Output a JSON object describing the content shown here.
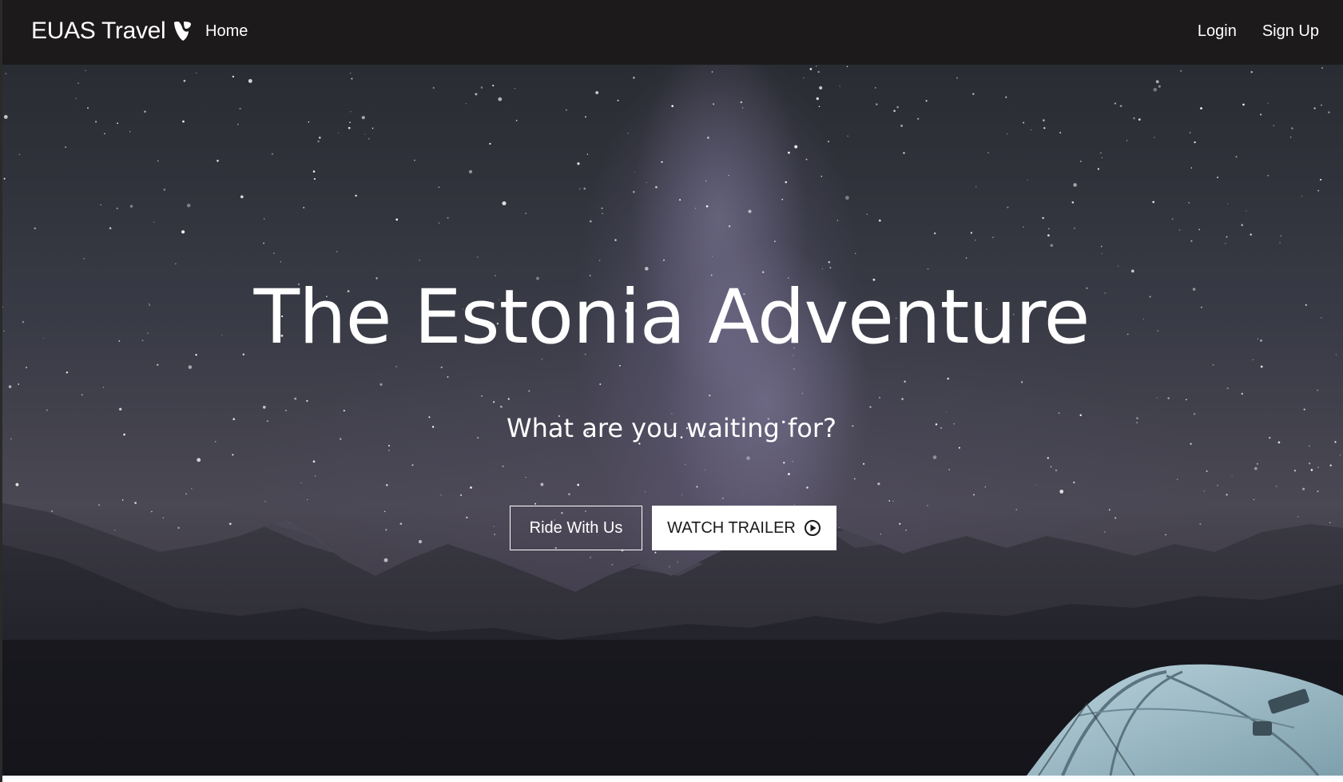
{
  "navbar": {
    "brand": "EUAS Travel",
    "brand_icon": "typo3-logo-icon",
    "links": {
      "home": "Home",
      "login": "Login",
      "signup": "Sign Up"
    }
  },
  "hero": {
    "title": "The Estonia Adventure",
    "subtitle": "What are you waiting for?",
    "buttons": {
      "ride": "Ride With Us",
      "trailer": "WATCH TRAILER",
      "trailer_icon": "play-circle-icon"
    },
    "background": "night-sky-mountains-tent"
  },
  "colors": {
    "navbar_bg": "#1c1a1b",
    "text": "#ffffff",
    "button_solid_bg": "#ffffff"
  }
}
